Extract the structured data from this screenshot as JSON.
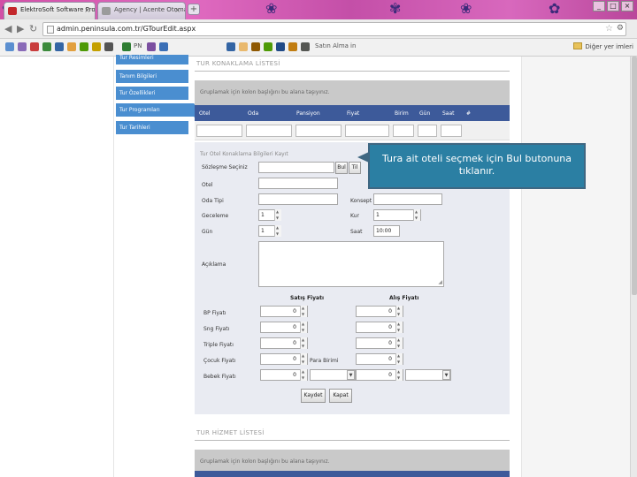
{
  "browser": {
    "tabs": [
      {
        "title": "ElektroSoft Software Prosta",
        "close": "×"
      },
      {
        "title": "Agency | Acente Otomasyonu",
        "close": "×"
      }
    ],
    "new_tab": "+",
    "window_controls": [
      "_",
      "□",
      "×"
    ],
    "address": "admin.peninsula.com.tr/GTourEdit.aspx",
    "bookmarks_bar": {
      "items": [
        "PN",
        "Satın Alma",
        "in"
      ],
      "other": "Diğer yer imleri"
    }
  },
  "sidebar": {
    "items": [
      {
        "label": "Tur Resimleri"
      },
      {
        "label": "Tanım Bilgileri"
      },
      {
        "label": "Tur Özellikleri"
      },
      {
        "label": "Tur Programları"
      },
      {
        "label": "Tur Tarihleri"
      }
    ],
    "active_index": 3
  },
  "main": {
    "section_title": "TUR KONAKLAMA LİSTESİ",
    "group_hint": "Gruplamak için kolon başlığını bu alana taşıyınız.",
    "grid_columns": [
      "Otel",
      "Oda",
      "Pansiyon",
      "Fiyat",
      "Birim",
      "Gün",
      "Saat",
      "#"
    ],
    "form": {
      "title": "Tur Otel Konaklama Bilgileri Kayıt",
      "labels": {
        "sozlesme": "Sözleşme Seçiniz",
        "otel": "Otel",
        "oda_tipi": "Oda Tipi",
        "gece": "Geceleme",
        "gun": "Gün",
        "aciklama": "Açıklama",
        "konsept": "Konsept",
        "kur": "Kur",
        "saat": "Saat"
      },
      "bul_button": "Bul",
      "temizle_button": "Til",
      "values": {
        "geceleme": "1",
        "gun": "1",
        "kur": "1",
        "saat": "10:00"
      },
      "price_headers": {
        "satis": "Satış Fiyatı",
        "alis": "Alış Fiyatı"
      },
      "price_rows": [
        {
          "label": "BP Fiyatı",
          "satis": "0",
          "alis": "0"
        },
        {
          "label": "Sng Fiyatı",
          "satis": "0",
          "alis": "0"
        },
        {
          "label": "Triple Fiyatı",
          "satis": "0",
          "alis": "0"
        },
        {
          "label": "Çocuk Fiyatı",
          "satis": "0",
          "alis": "0"
        },
        {
          "label": "Bebek Fiyatı",
          "satis": "0",
          "alis": "0"
        }
      ],
      "para_birimi_label": "Para Birimi",
      "save_button": "Kaydet",
      "close_button": "Kapat"
    },
    "section2_title": "TUR HİZMET LİSTESİ",
    "group_hint2": "Gruplamak için kolon başlığını bu alana taşıyınız."
  },
  "callout": {
    "text": "Tura ait oteli seçmek için Bul butonuna tıklanır."
  },
  "colors": {
    "sidebar_blue": "#4a8ed0",
    "grid_header": "#3d5a9a",
    "callout_bg": "#2b7fa3",
    "chrome_theme": "#d24fa6"
  }
}
